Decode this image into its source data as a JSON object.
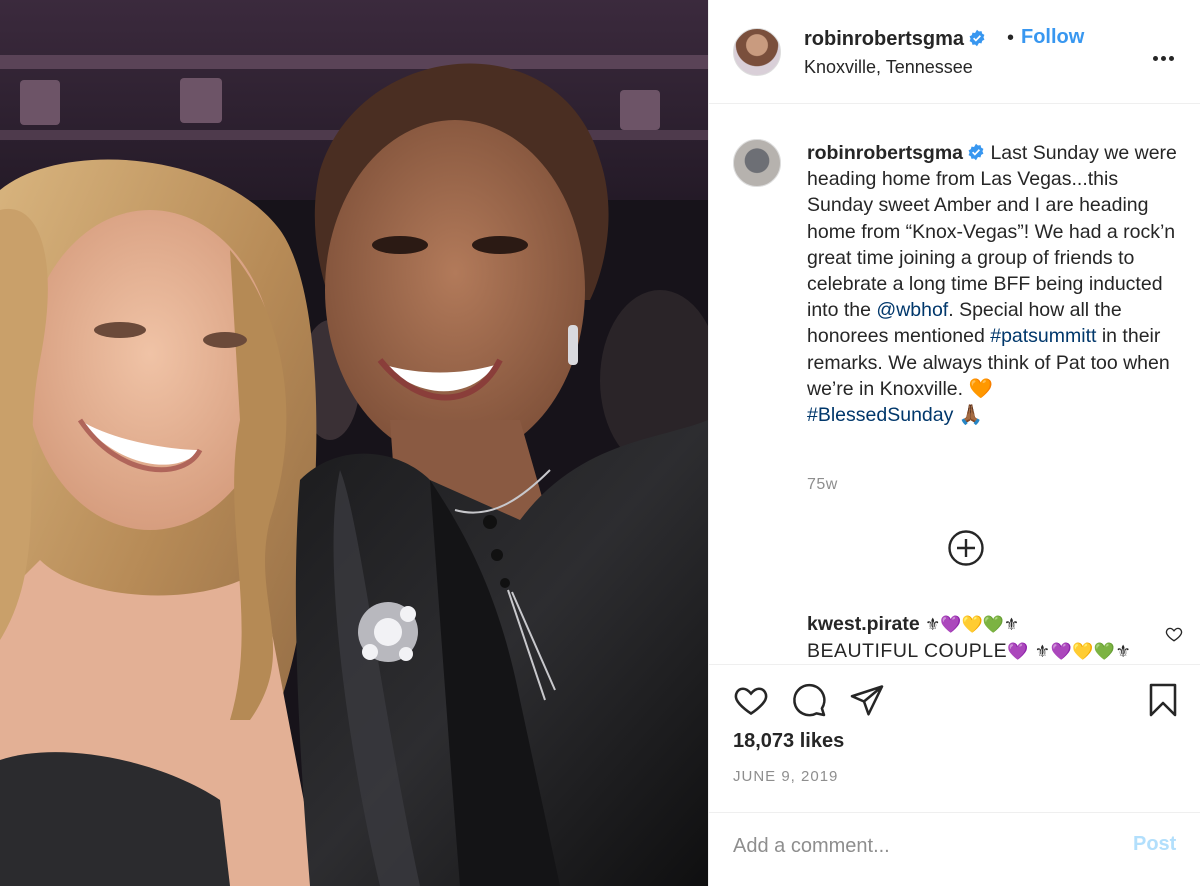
{
  "post": {
    "username": "robinrobertsgma",
    "follow_label": "Follow",
    "separator": "•",
    "location": "Knoxville, Tennessee",
    "caption": {
      "username": "robinrobertsgma",
      "text_1": " Last Sunday we were heading home from Las Vegas...this Sunday sweet Amber and I are heading home from “Knox-Vegas”! We had a rock’n great time joining a group of friends to celebrate a long time BFF being inducted into the ",
      "mention": "@wbhof",
      "text_2": ". Special how all the honorees mentioned ",
      "hashtag_1": "#patsummitt",
      "text_3": " in their remarks. We always think of Pat too when we’re in Knoxville. 🧡",
      "hashtag_2": "#BlessedSunday",
      "text_4": " 🙏🏾"
    },
    "time_ago": "75w",
    "likes": "18,073 likes",
    "date": "JUNE 9, 2019"
  },
  "comments": [
    {
      "username": "kwest.pirate",
      "username_emoji": " ⚜💜💛💚⚜",
      "text": "BEAUTIFUL COUPLE",
      "text_emoji": "💜 ⚜💜💛💚⚜"
    }
  ],
  "comment_box": {
    "placeholder": "Add a comment...",
    "post_label": "Post"
  },
  "icons": {
    "verified": "verified-badge-icon",
    "more": "more-options-icon",
    "load_more": "plus-circle-icon",
    "like": "heart-icon",
    "comment": "comment-bubble-icon",
    "share": "paper-plane-icon",
    "save": "bookmark-icon"
  },
  "colors": {
    "follow": "#3897f0",
    "link": "#00376b",
    "verified": "#3897f0",
    "secondary_text": "#8e8e8e",
    "post_disabled": "#b2dffc"
  }
}
